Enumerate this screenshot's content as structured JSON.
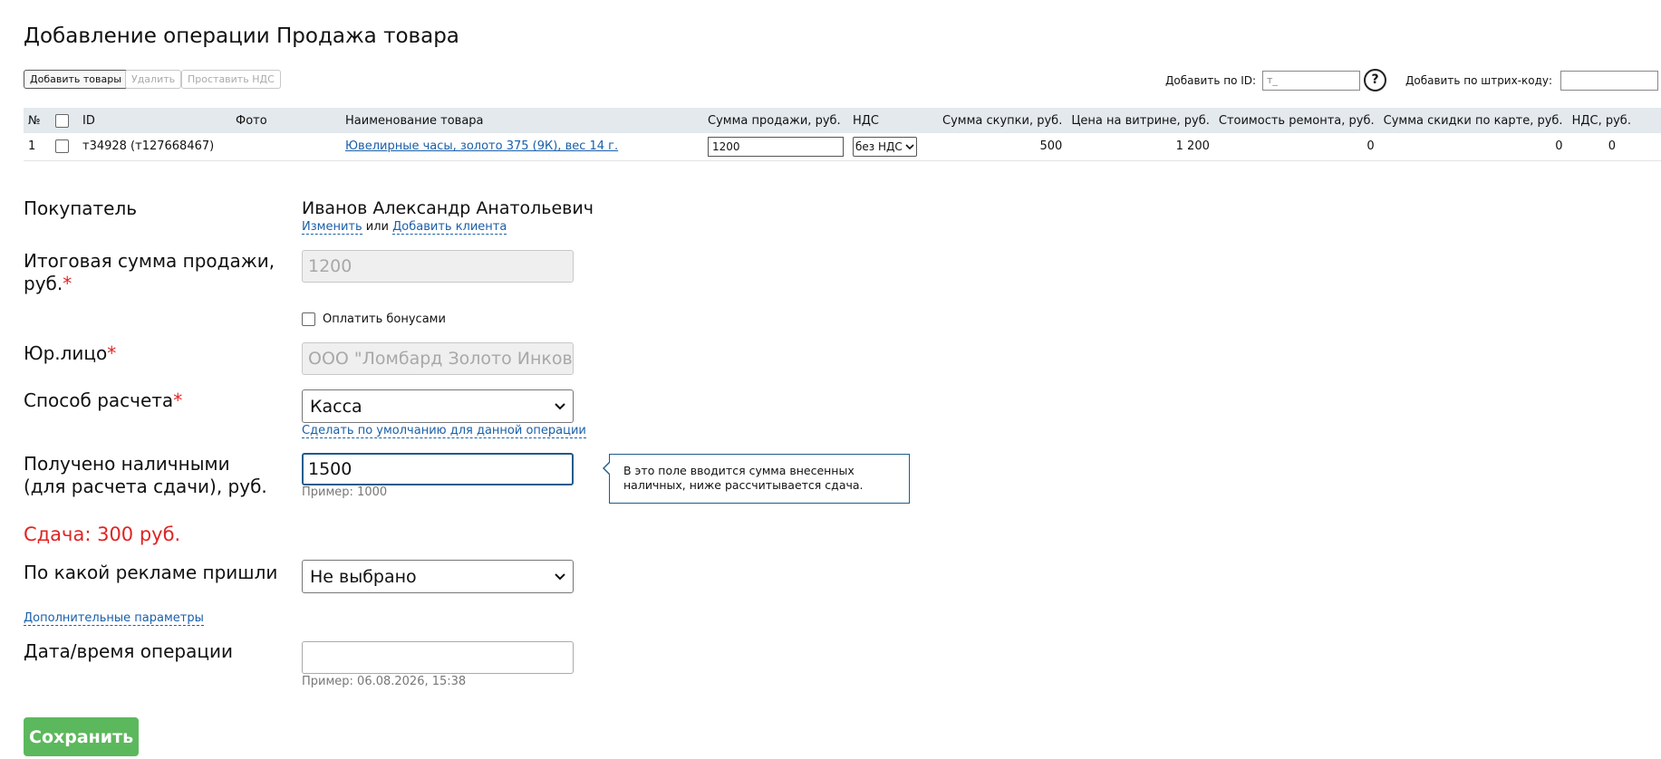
{
  "page": {
    "title": "Добавление операции Продажа товара"
  },
  "toolbar": {
    "add_goods": "Добавить товары",
    "delete": "Удалить",
    "set_vat": "Проставить НДС",
    "add_by_id_label": "Добавить по ID:",
    "add_by_id_value": "т_",
    "help": "?",
    "add_by_barcode_label": "Добавить по штрих-коду:",
    "add_by_barcode_value": ""
  },
  "table": {
    "headers": {
      "num": "№",
      "id": "ID",
      "photo": "Фото",
      "name": "Наименование товара",
      "sale_sum": "Сумма продажи, руб.",
      "vat": "НДС",
      "purchase_sum": "Сумма скупки, руб.",
      "showcase_price": "Цена на витрине, руб.",
      "repair_cost": "Стоимость ремонта, руб.",
      "card_discount": "Сумма скидки по карте, руб.",
      "vat_sum": "НДС, руб."
    },
    "rows": [
      {
        "num": "1",
        "id": "т34928 (т127668467)",
        "photo": "",
        "name": "Ювелирные часы, золото 375 (9К), вес 14 г.",
        "sale_sum": "1200",
        "vat": "без НДС",
        "purchase_sum": "500",
        "showcase_price": "1 200",
        "repair_cost": "0",
        "card_discount": "0",
        "vat_sum": "0"
      }
    ]
  },
  "form": {
    "buyer": {
      "label": "Покупатель",
      "value": "Иванов Александр Анатольевич",
      "change_link": "Изменить",
      "or": "или",
      "add_client_link": "Добавить клиента"
    },
    "total": {
      "label": "Итоговая сумма продажи, руб.",
      "value": "1200"
    },
    "pay_bonuses": {
      "label": "Оплатить бонусами",
      "checked": false
    },
    "legal_entity": {
      "label": "Юр.лицо",
      "value": "ООО \"Ломбард Золото Инков за"
    },
    "payment_method": {
      "label": "Способ расчета",
      "value": "Касса",
      "default_link": "Сделать по умолчанию для данной операции"
    },
    "cash_received": {
      "label": "Получено наличными (для расчета сдачи), руб.",
      "value": "1500",
      "hint": "Пример: 1000",
      "tooltip": "В это поле вводится сумма внесенных наличных, ниже рассчитывается сдача."
    },
    "change": {
      "text": "Сдача: 300 руб."
    },
    "advertising": {
      "label": "По какой рекламе пришли",
      "value": "Не выбрано"
    },
    "extra_params_link": "Дополнительные параметры",
    "datetime": {
      "label": "Дата/время операции",
      "value": "",
      "hint": "Пример: 06.08.2026, 15:38"
    },
    "save": "Сохранить",
    "required_mark": "*"
  },
  "colors": {
    "header_bg": "#e3e9ed",
    "link": "#1a5fa8",
    "required": "#e02424",
    "save_button": "#5cb85c",
    "focus_border": "#1e5c8c"
  }
}
